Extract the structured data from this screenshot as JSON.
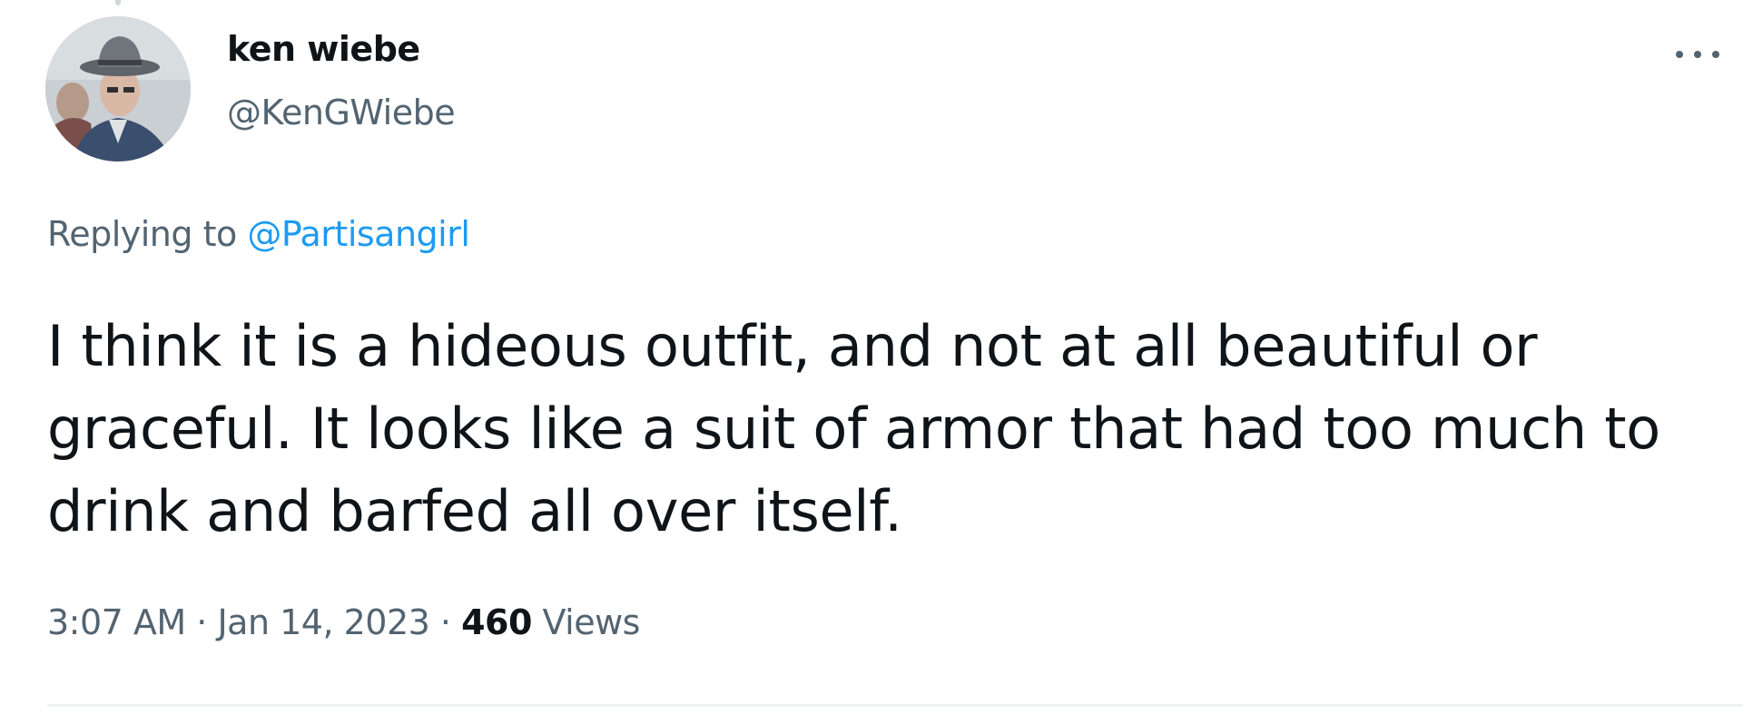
{
  "author": {
    "display_name": "ken wiebe",
    "handle": "@KenGWiebe",
    "avatar_icon": "user-avatar-photo"
  },
  "menu": {
    "more_icon": "more-horizontal-icon"
  },
  "reply": {
    "prefix": "Replying to ",
    "mention": "@Partisangirl"
  },
  "tweet": {
    "text": "I think it is a hideous outfit, and not at all beautiful or graceful. It looks like a suit of armor that had too much to drink and barfed all over itself."
  },
  "meta": {
    "time": "3:07 AM",
    "separator": " · ",
    "date": "Jan 14, 2023",
    "views_count": "460",
    "views_label": " Views"
  },
  "colors": {
    "text": "#0f1419",
    "secondary": "#536471",
    "accent": "#1d9bf0",
    "divider": "#eff3f4"
  }
}
